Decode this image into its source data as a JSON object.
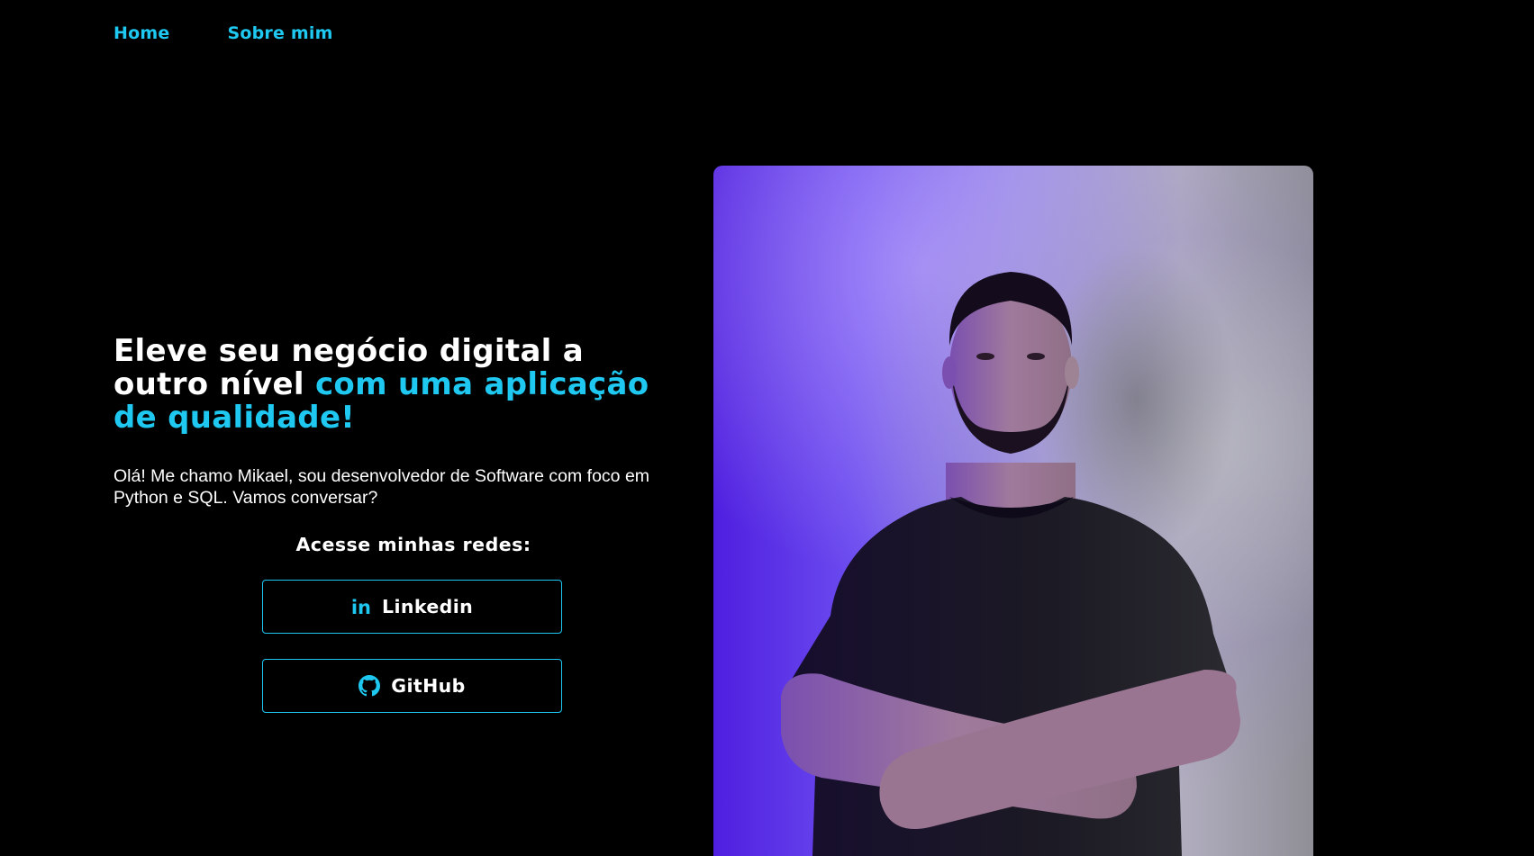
{
  "nav": {
    "items": [
      {
        "label": "Home"
      },
      {
        "label": "Sobre mim"
      }
    ]
  },
  "hero": {
    "headline_main": "Eleve seu negócio digital a outro nível ",
    "headline_accent": "com uma aplicação de qualidade!",
    "intro": "Olá! Me chamo Mikael, sou desenvolvedor de Software com foco em Python e SQL. Vamos conversar?",
    "social_title": "Acesse minhas redes:",
    "social": [
      {
        "label": "Linkedin",
        "icon": "linkedin-icon",
        "icon_text": "in"
      },
      {
        "label": "GitHub",
        "icon": "github-icon"
      }
    ]
  },
  "colors": {
    "background": "#000000",
    "accent": "#1ec8f0",
    "text": "#ffffff"
  }
}
